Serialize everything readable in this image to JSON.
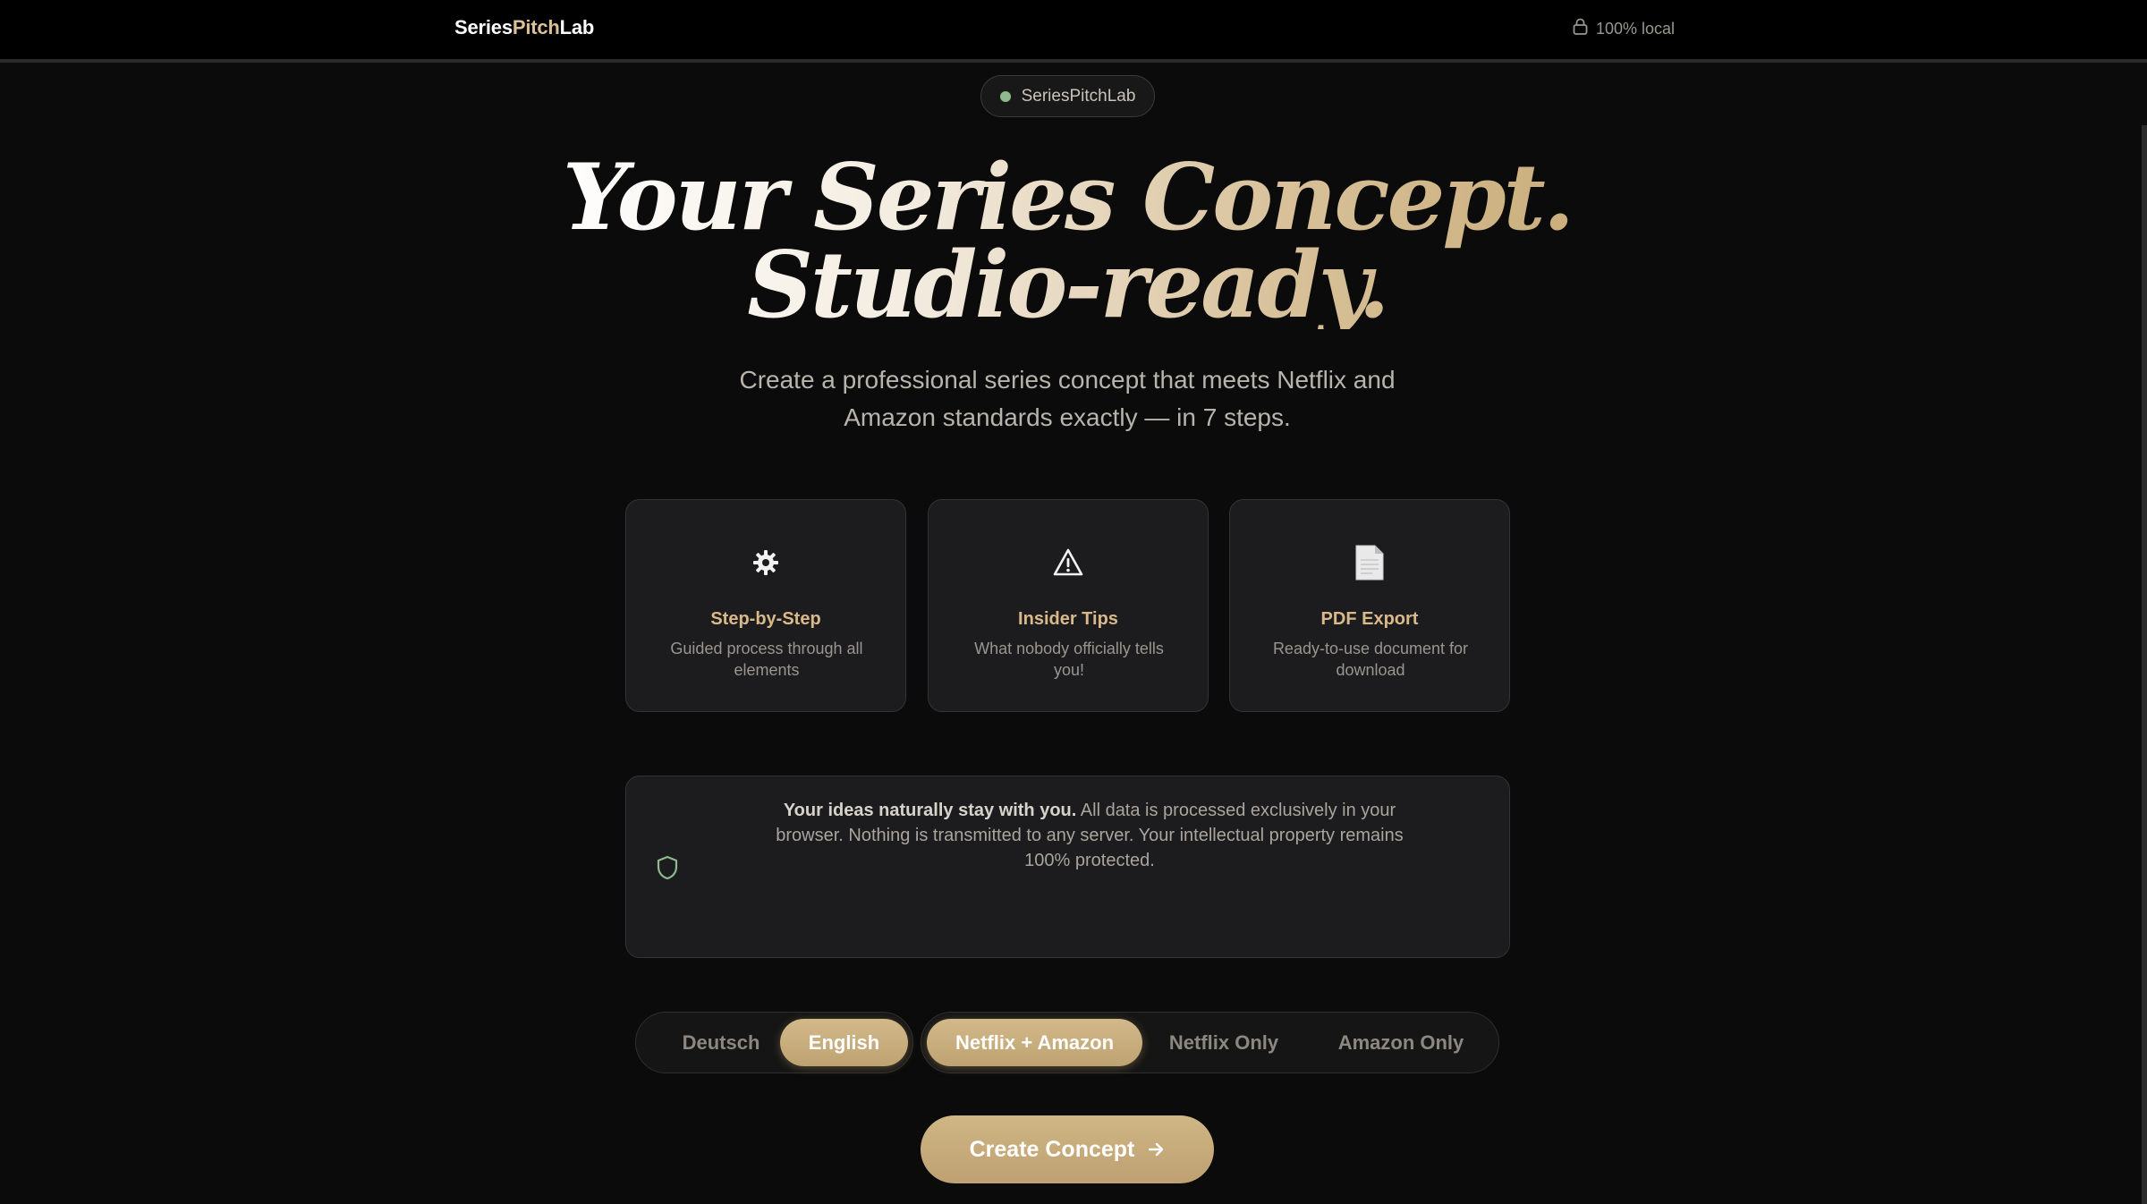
{
  "nav": {
    "brand_part1": "Series",
    "brand_part2": "Pitch",
    "brand_part3": "Lab",
    "local_label": "100% local",
    "local_icon": "lock-icon"
  },
  "badge": {
    "label": "SeriesPitchLab",
    "dot_color": "#8fb98f"
  },
  "hero": {
    "line1": "Your Series Concept.",
    "line2": "Studio-ready.",
    "subtitle": "Create a professional series concept that meets Netflix and Amazon standards exactly — in 7 steps."
  },
  "features": [
    {
      "icon": "gear-icon",
      "title": "Step-by-Step",
      "desc": "Guided process through all elements"
    },
    {
      "icon": "warning-icon",
      "title": "Insider Tips",
      "desc": "What nobody officially tells you!"
    },
    {
      "icon": "document-icon",
      "title": "PDF Export",
      "desc": "Ready-to-use document for download"
    }
  ],
  "privacy": {
    "icon": "shield-icon",
    "bold": "Your ideas naturally stay with you.",
    "text": " All data is processed exclusively in your browser. Nothing is transmitted to any server. Your intellectual property remains 100% protected."
  },
  "language_toggle": {
    "options": [
      "Deutsch",
      "English"
    ],
    "selected": "English"
  },
  "platform_toggle": {
    "options": [
      "Netflix + Amazon",
      "Netflix Only",
      "Amazon Only"
    ],
    "selected": "Netflix + Amazon"
  },
  "cta": {
    "label": "Create Concept",
    "icon": "arrow-right-icon"
  },
  "colors": {
    "accent": "#c9ad7a",
    "background": "#0b0b0b",
    "card": "#1c1c1e"
  }
}
